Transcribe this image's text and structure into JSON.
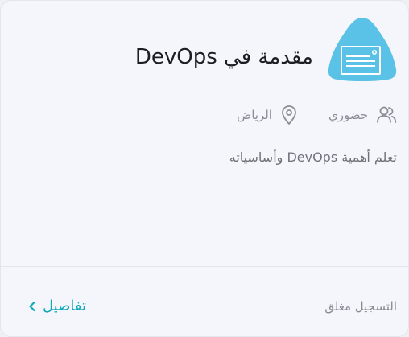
{
  "course": {
    "title": "مقدمة في DevOps",
    "icon": "certificate-document-icon",
    "icon_color": "#5bc2e7",
    "meta": {
      "attendance_icon": "users-icon",
      "attendance_label": "حضوري",
      "location_icon": "map-pin-icon",
      "location_label": "الرياض"
    },
    "description": "تعلم أهمية DevOps وأساسياته"
  },
  "footer": {
    "status_label": "التسجيل مغلق",
    "details_label": "تفاصيل",
    "details_icon": "chevron-left-icon",
    "accent_color": "#11a8b8"
  }
}
